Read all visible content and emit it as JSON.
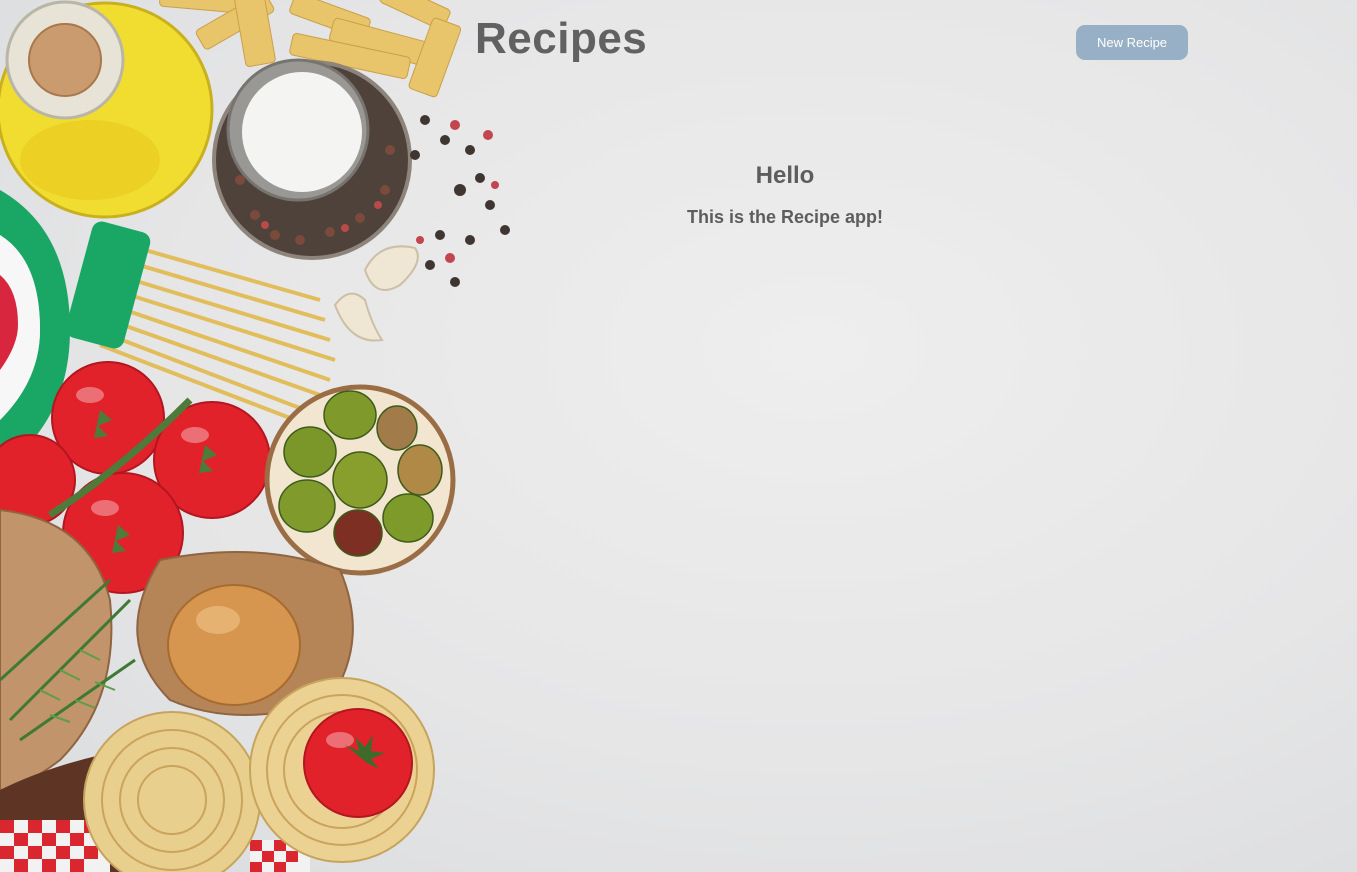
{
  "header": {
    "title": "Recipes",
    "new_recipe_label": "New Recipe"
  },
  "welcome": {
    "heading": "Hello",
    "message": "This is the Recipe app!"
  },
  "background": {
    "description_icon": "food-ingredients-photo-icon"
  },
  "colors": {
    "button": "#98b0c6",
    "text": "#616161",
    "background": "#e9e9ea"
  }
}
